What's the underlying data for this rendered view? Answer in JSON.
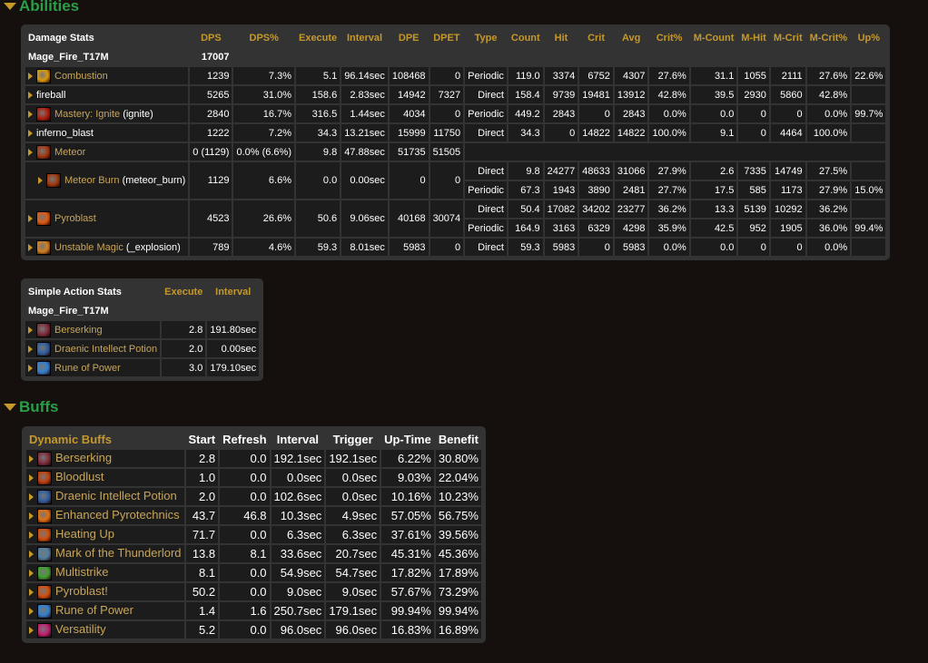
{
  "sections": {
    "abilities": "Abilities",
    "buffs": "Buffs"
  },
  "colors": {
    "background": "#150f0d",
    "panel": "#333333",
    "header_gold": "#c5982a",
    "section_green": "#2a9e48",
    "link": "#c8a55a"
  },
  "damage_stats": {
    "headers": [
      "Damage Stats",
      "DPS",
      "DPS%",
      "Execute",
      "Interval",
      "DPE",
      "DPET",
      "Type",
      "Count",
      "Hit",
      "Crit",
      "Avg",
      "Crit%",
      "M-Count",
      "M-Hit",
      "M-Crit",
      "M-Crit%",
      "Up%"
    ],
    "player": "Mage_Fire_T17M",
    "player_dps": "17007",
    "rows": [
      {
        "name": "Combustion",
        "icon": "combustion-icon",
        "color": "#d89a10",
        "link": true,
        "vals": [
          "1239",
          "7.3%",
          "5.1",
          "96.14sec",
          "108468",
          "0"
        ],
        "sub": [
          [
            "Periodic",
            "119.0",
            "3374",
            "6752",
            "4307",
            "27.6%",
            "31.1",
            "1055",
            "2111",
            "27.6%",
            "22.6%"
          ]
        ]
      },
      {
        "name": "fireball",
        "icon": "",
        "link": false,
        "vals": [
          "5265",
          "31.0%",
          "158.6",
          "2.83sec",
          "14942",
          "7327"
        ],
        "sub": [
          [
            "Direct",
            "158.4",
            "9739",
            "19481",
            "13912",
            "42.8%",
            "39.5",
            "2930",
            "5860",
            "42.8%",
            ""
          ]
        ]
      },
      {
        "name": "Mastery: Ignite",
        "suffix": " (ignite)",
        "icon": "ignite-icon",
        "color": "#b02010",
        "link": true,
        "vals": [
          "2840",
          "16.7%",
          "316.5",
          "1.44sec",
          "4034",
          "0"
        ],
        "sub": [
          [
            "Periodic",
            "449.2",
            "2843",
            "0",
            "2843",
            "0.0%",
            "0.0",
            "0",
            "0",
            "0.0%",
            "99.7%"
          ]
        ]
      },
      {
        "name": "inferno_blast",
        "icon": "",
        "link": false,
        "vals": [
          "1222",
          "7.2%",
          "34.3",
          "13.21sec",
          "15999",
          "11750"
        ],
        "sub": [
          [
            "Direct",
            "34.3",
            "0",
            "14822",
            "14822",
            "100.0%",
            "9.1",
            "0",
            "4464",
            "100.0%",
            ""
          ]
        ]
      },
      {
        "name": "Meteor",
        "icon": "meteor-icon",
        "color": "#a03a10",
        "link": true,
        "vals": [
          "0 (1129)",
          "0.0% (6.6%)",
          "9.8",
          "47.88sec",
          "51735",
          "51505"
        ],
        "sub": []
      },
      {
        "name": "Meteor Burn",
        "suffix": " (meteor_burn)",
        "child": true,
        "icon": "meteor-burn-icon",
        "color": "#a03a10",
        "link": true,
        "vals": [
          "1129",
          "6.6%",
          "0.0",
          "0.00sec",
          "0",
          "0"
        ],
        "sub": [
          [
            "Direct",
            "9.8",
            "24277",
            "48633",
            "31066",
            "27.9%",
            "2.6",
            "7335",
            "14749",
            "27.5%",
            ""
          ],
          [
            "Periodic",
            "67.3",
            "1943",
            "3890",
            "2481",
            "27.7%",
            "17.5",
            "585",
            "1173",
            "27.9%",
            "15.0%"
          ]
        ]
      },
      {
        "name": "Pyroblast",
        "icon": "pyroblast-icon",
        "color": "#e05a10",
        "link": true,
        "vals": [
          "4523",
          "26.6%",
          "50.6",
          "9.06sec",
          "40168",
          "30074"
        ],
        "sub": [
          [
            "Direct",
            "50.4",
            "17082",
            "34202",
            "23277",
            "36.2%",
            "13.3",
            "5139",
            "10292",
            "36.2%",
            ""
          ],
          [
            "Periodic",
            "164.9",
            "3163",
            "6329",
            "4298",
            "35.9%",
            "42.5",
            "952",
            "1905",
            "36.0%",
            "99.4%"
          ]
        ]
      },
      {
        "name": "Unstable Magic",
        "suffix": " (_explosion)",
        "icon": "unstable-magic-icon",
        "color": "#d08020",
        "link": true,
        "vals": [
          "789",
          "4.6%",
          "59.3",
          "8.01sec",
          "5983",
          "0"
        ],
        "sub": [
          [
            "Direct",
            "59.3",
            "5983",
            "0",
            "5983",
            "0.0%",
            "0.0",
            "0",
            "0",
            "0.0%",
            ""
          ]
        ]
      }
    ]
  },
  "simple_action_stats": {
    "headers": [
      "Simple Action Stats",
      "Execute",
      "Interval"
    ],
    "player": "Mage_Fire_T17M",
    "rows": [
      {
        "name": "Berserking",
        "icon": "berserking-icon",
        "color": "#803040",
        "vals": [
          "2.8",
          "191.80sec"
        ]
      },
      {
        "name": "Draenic Intellect Potion",
        "icon": "potion-icon",
        "color": "#3060a0",
        "vals": [
          "2.0",
          "0.00sec"
        ]
      },
      {
        "name": "Rune of Power",
        "icon": "rune-of-power-icon",
        "color": "#3080d0",
        "vals": [
          "3.0",
          "179.10sec"
        ]
      }
    ]
  },
  "dynamic_buffs": {
    "headers": [
      "Dynamic Buffs",
      "Start",
      "Refresh",
      "Interval",
      "Trigger",
      "Up-Time",
      "Benefit"
    ],
    "rows": [
      {
        "name": "Berserking",
        "icon": "berserking-icon",
        "color": "#803040",
        "vals": [
          "2.8",
          "0.0",
          "192.1sec",
          "192.1sec",
          "6.22%",
          "30.80%"
        ]
      },
      {
        "name": "Bloodlust",
        "icon": "bloodlust-icon",
        "color": "#c04010",
        "vals": [
          "1.0",
          "0.0",
          "0.0sec",
          "0.0sec",
          "9.03%",
          "22.04%"
        ]
      },
      {
        "name": "Draenic Intellect Potion",
        "icon": "potion-icon",
        "color": "#3060a0",
        "vals": [
          "2.0",
          "0.0",
          "102.6sec",
          "0.0sec",
          "10.16%",
          "10.23%"
        ]
      },
      {
        "name": "Enhanced Pyrotechnics",
        "icon": "pyrotechnics-icon",
        "color": "#e07010",
        "vals": [
          "43.7",
          "46.8",
          "10.3sec",
          "4.9sec",
          "57.05%",
          "56.75%"
        ]
      },
      {
        "name": "Heating Up",
        "icon": "heating-up-icon",
        "color": "#d05010",
        "vals": [
          "71.7",
          "0.0",
          "6.3sec",
          "6.3sec",
          "37.61%",
          "39.56%"
        ]
      },
      {
        "name": "Mark of the Thunderlord",
        "icon": "thunderlord-icon",
        "color": "#5080a0",
        "vals": [
          "13.8",
          "8.1",
          "33.6sec",
          "20.7sec",
          "45.31%",
          "45.36%"
        ]
      },
      {
        "name": "Multistrike",
        "icon": "multistrike-icon",
        "color": "#40a030",
        "vals": [
          "8.1",
          "0.0",
          "54.9sec",
          "54.7sec",
          "17.82%",
          "17.89%"
        ]
      },
      {
        "name": "Pyroblast!",
        "icon": "pyroblast-icon",
        "color": "#d05010",
        "vals": [
          "50.2",
          "0.0",
          "9.0sec",
          "9.0sec",
          "57.67%",
          "73.29%"
        ]
      },
      {
        "name": "Rune of Power",
        "icon": "rune-of-power-icon",
        "color": "#3080d0",
        "vals": [
          "1.4",
          "1.6",
          "250.7sec",
          "179.1sec",
          "99.94%",
          "99.94%"
        ]
      },
      {
        "name": "Versatility",
        "icon": "versatility-icon",
        "color": "#c02070",
        "vals": [
          "5.2",
          "0.0",
          "96.0sec",
          "96.0sec",
          "16.83%",
          "16.89%"
        ]
      }
    ]
  }
}
